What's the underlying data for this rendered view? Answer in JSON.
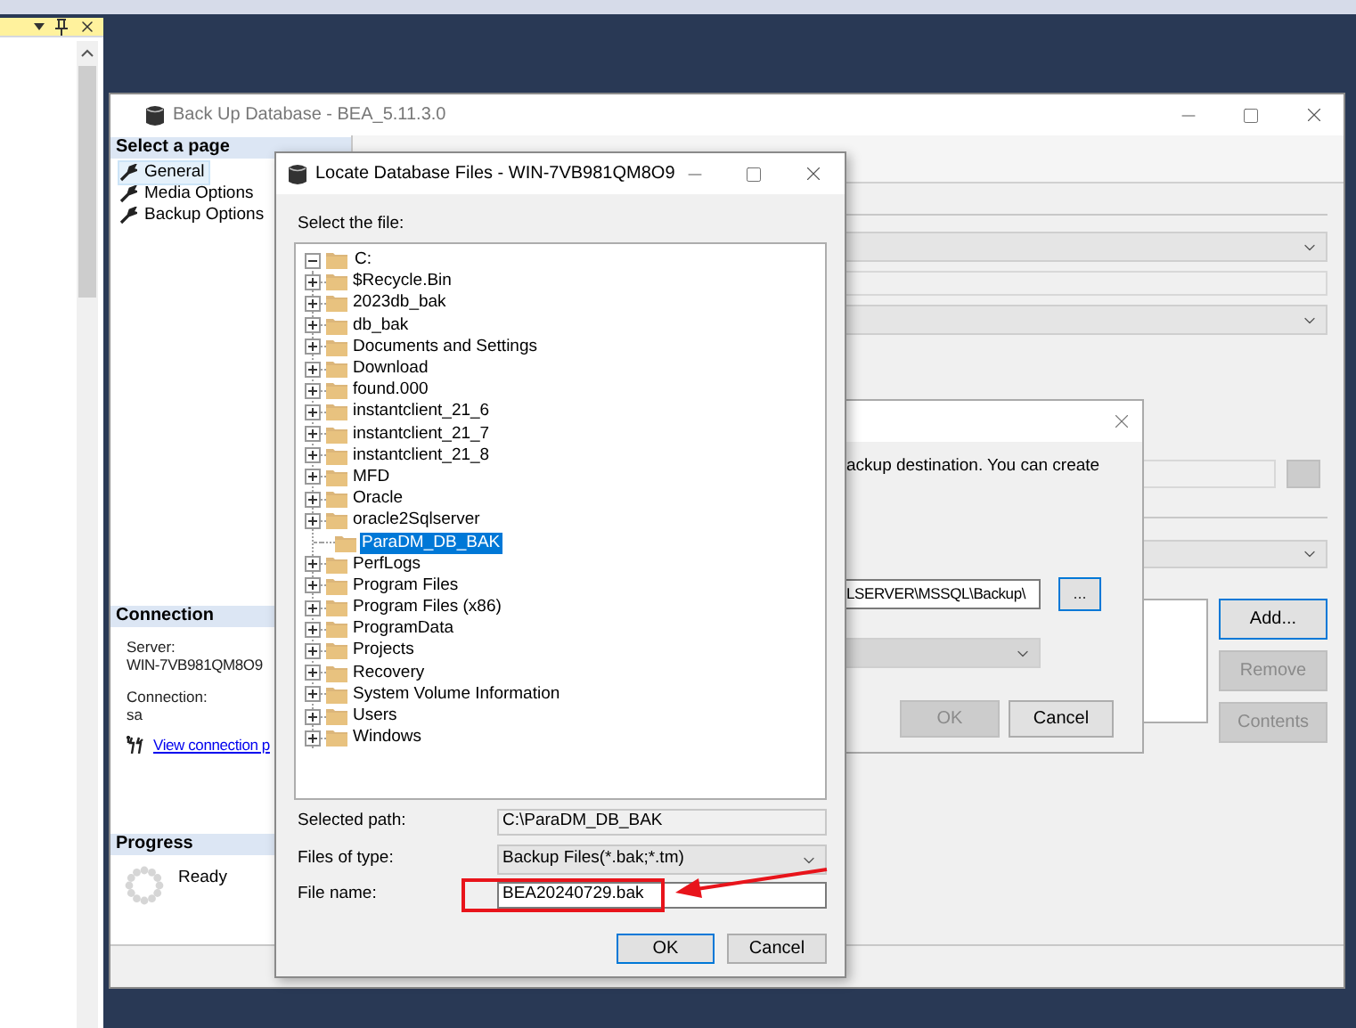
{
  "backup_window": {
    "title": "Back Up Database - BEA_5.11.3.0",
    "pages_heading": "Select a page",
    "pages": [
      {
        "label": "General",
        "selected": true
      },
      {
        "label": "Media Options",
        "selected": false
      },
      {
        "label": "Backup Options",
        "selected": false
      }
    ],
    "connection": {
      "heading": "Connection",
      "server_label": "Server:",
      "server": "WIN-7VB981QM8O9",
      "connection_label": "Connection:",
      "connection": "sa",
      "link": "View connection p"
    },
    "progress": {
      "heading": "Progress",
      "status": "Ready"
    },
    "buttons": [
      {
        "label": "Add...",
        "disabled": false
      },
      {
        "label": "Remove",
        "disabled": true
      },
      {
        "label": "Contents",
        "disabled": true
      }
    ]
  },
  "destination_dialog": {
    "message": "ackup destination. You can create",
    "path": "LSERVER\\MSSQL\\Backup\\",
    "browse_button": "...",
    "buttons": [
      {
        "label": "OK",
        "disabled": true
      },
      {
        "label": "Cancel",
        "disabled": false
      }
    ]
  },
  "locate_dialog": {
    "title": "Locate Database Files - WIN-7VB981QM8O9",
    "prompt": "Select the file:",
    "tree": {
      "label": "C:",
      "expanded": true,
      "children": [
        {
          "label": "$Recycle.Bin",
          "expandable": true,
          "selected": false
        },
        {
          "label": "2023db_bak",
          "expandable": true,
          "selected": false
        },
        {
          "label": "db_bak",
          "expandable": true,
          "selected": false
        },
        {
          "label": "Documents and Settings",
          "expandable": true,
          "selected": false
        },
        {
          "label": "Download",
          "expandable": true,
          "selected": false
        },
        {
          "label": "found.000",
          "expandable": true,
          "selected": false
        },
        {
          "label": "instantclient_21_6",
          "expandable": true,
          "selected": false
        },
        {
          "label": "instantclient_21_7",
          "expandable": true,
          "selected": false
        },
        {
          "label": "instantclient_21_8",
          "expandable": true,
          "selected": false
        },
        {
          "label": "MFD",
          "expandable": true,
          "selected": false
        },
        {
          "label": "Oracle",
          "expandable": true,
          "selected": false
        },
        {
          "label": "oracle2Sqlserver",
          "expandable": true,
          "selected": false
        },
        {
          "label": "ParaDM_DB_BAK",
          "expandable": false,
          "selected": true
        },
        {
          "label": "PerfLogs",
          "expandable": true,
          "selected": false
        },
        {
          "label": "Program Files",
          "expandable": true,
          "selected": false
        },
        {
          "label": "Program Files (x86)",
          "expandable": true,
          "selected": false
        },
        {
          "label": "ProgramData",
          "expandable": true,
          "selected": false
        },
        {
          "label": "Projects",
          "expandable": true,
          "selected": false
        },
        {
          "label": "Recovery",
          "expandable": true,
          "selected": false
        },
        {
          "label": "System Volume Information",
          "expandable": true,
          "selected": false
        },
        {
          "label": "Users",
          "expandable": true,
          "selected": false
        },
        {
          "label": "Windows",
          "expandable": true,
          "selected": false
        }
      ]
    },
    "selected_path_label": "Selected path:",
    "selected_path": "C:\\ParaDM_DB_BAK",
    "files_of_type_label": "Files of type:",
    "files_of_type": "Backup Files(*.bak;*.tm)",
    "file_name_label": "File name:",
    "file_name": "BEA20240729.bak",
    "buttons": [
      {
        "label": "OK",
        "disabled": false
      },
      {
        "label": "Cancel",
        "disabled": false
      }
    ]
  }
}
